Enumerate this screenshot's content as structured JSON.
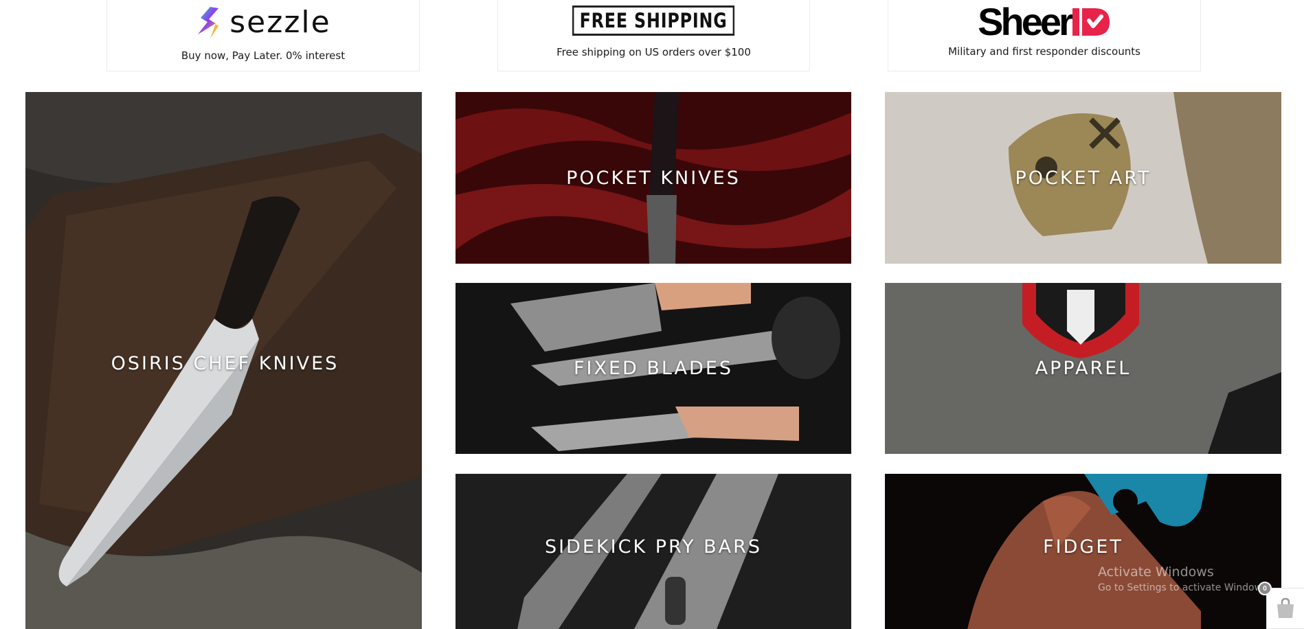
{
  "info_strip": {
    "sezzle": {
      "logo_text": "sezzle",
      "caption": "Buy now, Pay Later. 0% interest"
    },
    "shipping": {
      "logo_text": "FREE SHIPPING",
      "caption": "Free shipping on US orders over $100"
    },
    "sheerid": {
      "logo_text": "Sheer",
      "caption": "Military and first responder discounts"
    }
  },
  "categories": [
    {
      "label": "OSIRIS CHEF KNIVES"
    },
    {
      "label": "POCKET KNIVES"
    },
    {
      "label": "POCKET ART"
    },
    {
      "label": "FIXED BLADES"
    },
    {
      "label": "APPAREL"
    },
    {
      "label": "SIDEKICK PRY BARS"
    },
    {
      "label": "FIDGET"
    }
  ],
  "os_watermark": {
    "title": "Activate Windows",
    "subtitle": "Go to Settings to activate Windows."
  },
  "cart": {
    "count": "0",
    "icon": "shopping-bag-icon"
  },
  "colors": {
    "sheerid_accent": "#e8234a",
    "sezzle_gradient": [
      "#8c3cf5",
      "#f5a623"
    ]
  }
}
